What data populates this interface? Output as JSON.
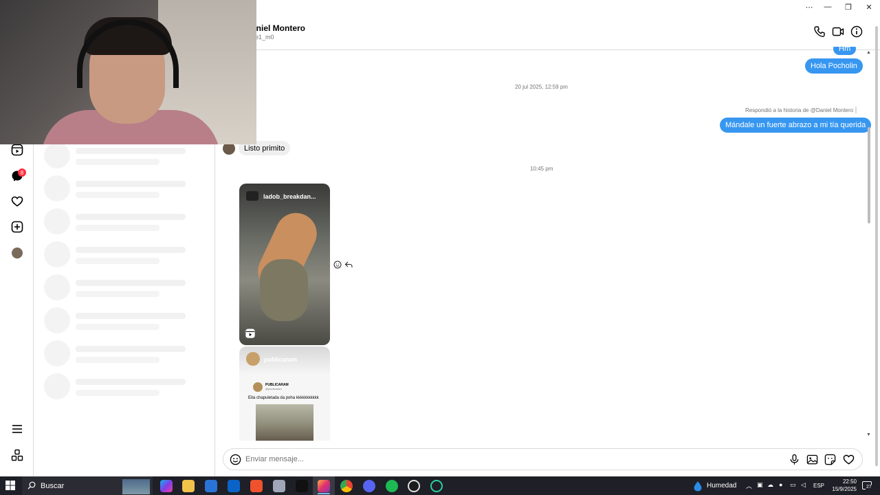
{
  "conversation": {
    "name": "aniel Montero",
    "username": "1e1_m0"
  },
  "messages": {
    "partial_top": "Hm",
    "outgoing_1": "Hola Pocholin",
    "date_separator_1": "20 jul 2025, 12:59 pm",
    "story_reply_note": "Respondió a la historia de @Daniel Montero",
    "outgoing_2": "Mándale un fuerte abrazo a mi tía querida",
    "incoming_1": "Listo primito",
    "time_separator_2": "10:45 pm",
    "reel_account": "ladob_breakdan...",
    "post_account": "publicaram",
    "post_inner_name": "PUBLICARAM",
    "post_inner_user": "@publicaram",
    "post_caption": "Eita chapuletada da poha kkkkkkkkkkk"
  },
  "composer": {
    "placeholder": "Enviar mensaje..."
  },
  "rail": {
    "notification_count": "8"
  },
  "taskbar": {
    "search_label": "Buscar",
    "weather_label": "Humedad",
    "language": "ESP",
    "time": "22:50",
    "date": "15/9/2025",
    "notification_count": "27"
  },
  "colors": {
    "accent_blue": "#3797f0",
    "badge_red": "#ff3040",
    "taskbar_bg": "#1f1f27"
  }
}
